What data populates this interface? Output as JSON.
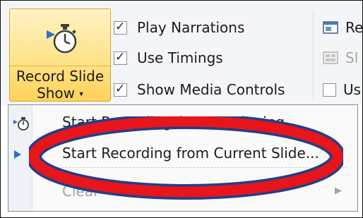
{
  "record_button": {
    "label_line1": "Record Slide",
    "label_line2": "Show",
    "arrow": "▾",
    "icon": "stopwatch-icon"
  },
  "options": [
    {
      "label": "Play Narrations",
      "checked": true
    },
    {
      "label": "Use Timings",
      "checked": true
    },
    {
      "label": "Show Media Controls",
      "checked": true
    }
  ],
  "right_column": [
    {
      "label": "Re",
      "icon": "window-icon",
      "dim": false
    },
    {
      "label": "Sl",
      "icon": "slide-icon",
      "dim": true
    },
    {
      "label": "Us",
      "icon": "checkbox-icon",
      "dim": false
    }
  ],
  "menu": {
    "items": [
      {
        "label": "Start Recording from Beginning...",
        "icon": "stopwatch-icon",
        "enabled": true,
        "partially_obscured": true
      },
      {
        "label": "Start Recording from Current Slide...",
        "icon": "play-arrow-icon",
        "enabled": true
      },
      {
        "label": "Clear",
        "icon": "",
        "enabled": false,
        "has_submenu": true
      }
    ]
  },
  "annotation": {
    "highlight_color": "#e8151b",
    "outline_color": "#1f3f8a",
    "shape": "ellipse"
  }
}
